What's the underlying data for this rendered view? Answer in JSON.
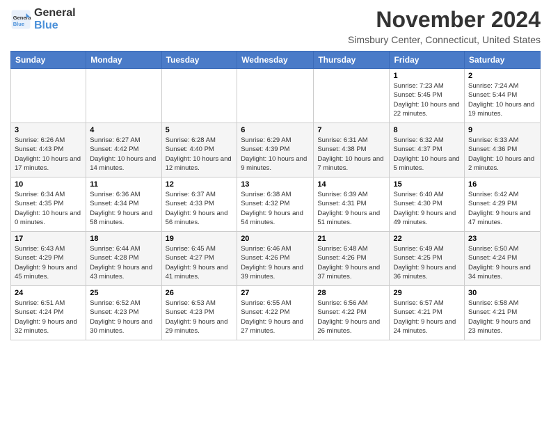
{
  "logo": {
    "line1": "General",
    "line2": "Blue"
  },
  "title": "November 2024",
  "subtitle": "Simsbury Center, Connecticut, United States",
  "weekdays": [
    "Sunday",
    "Monday",
    "Tuesday",
    "Wednesday",
    "Thursday",
    "Friday",
    "Saturday"
  ],
  "weeks": [
    [
      {
        "day": "",
        "info": ""
      },
      {
        "day": "",
        "info": ""
      },
      {
        "day": "",
        "info": ""
      },
      {
        "day": "",
        "info": ""
      },
      {
        "day": "",
        "info": ""
      },
      {
        "day": "1",
        "info": "Sunrise: 7:23 AM\nSunset: 5:45 PM\nDaylight: 10 hours and 22 minutes."
      },
      {
        "day": "2",
        "info": "Sunrise: 7:24 AM\nSunset: 5:44 PM\nDaylight: 10 hours and 19 minutes."
      }
    ],
    [
      {
        "day": "3",
        "info": "Sunrise: 6:26 AM\nSunset: 4:43 PM\nDaylight: 10 hours and 17 minutes."
      },
      {
        "day": "4",
        "info": "Sunrise: 6:27 AM\nSunset: 4:42 PM\nDaylight: 10 hours and 14 minutes."
      },
      {
        "day": "5",
        "info": "Sunrise: 6:28 AM\nSunset: 4:40 PM\nDaylight: 10 hours and 12 minutes."
      },
      {
        "day": "6",
        "info": "Sunrise: 6:29 AM\nSunset: 4:39 PM\nDaylight: 10 hours and 9 minutes."
      },
      {
        "day": "7",
        "info": "Sunrise: 6:31 AM\nSunset: 4:38 PM\nDaylight: 10 hours and 7 minutes."
      },
      {
        "day": "8",
        "info": "Sunrise: 6:32 AM\nSunset: 4:37 PM\nDaylight: 10 hours and 5 minutes."
      },
      {
        "day": "9",
        "info": "Sunrise: 6:33 AM\nSunset: 4:36 PM\nDaylight: 10 hours and 2 minutes."
      }
    ],
    [
      {
        "day": "10",
        "info": "Sunrise: 6:34 AM\nSunset: 4:35 PM\nDaylight: 10 hours and 0 minutes."
      },
      {
        "day": "11",
        "info": "Sunrise: 6:36 AM\nSunset: 4:34 PM\nDaylight: 9 hours and 58 minutes."
      },
      {
        "day": "12",
        "info": "Sunrise: 6:37 AM\nSunset: 4:33 PM\nDaylight: 9 hours and 56 minutes."
      },
      {
        "day": "13",
        "info": "Sunrise: 6:38 AM\nSunset: 4:32 PM\nDaylight: 9 hours and 54 minutes."
      },
      {
        "day": "14",
        "info": "Sunrise: 6:39 AM\nSunset: 4:31 PM\nDaylight: 9 hours and 51 minutes."
      },
      {
        "day": "15",
        "info": "Sunrise: 6:40 AM\nSunset: 4:30 PM\nDaylight: 9 hours and 49 minutes."
      },
      {
        "day": "16",
        "info": "Sunrise: 6:42 AM\nSunset: 4:29 PM\nDaylight: 9 hours and 47 minutes."
      }
    ],
    [
      {
        "day": "17",
        "info": "Sunrise: 6:43 AM\nSunset: 4:29 PM\nDaylight: 9 hours and 45 minutes."
      },
      {
        "day": "18",
        "info": "Sunrise: 6:44 AM\nSunset: 4:28 PM\nDaylight: 9 hours and 43 minutes."
      },
      {
        "day": "19",
        "info": "Sunrise: 6:45 AM\nSunset: 4:27 PM\nDaylight: 9 hours and 41 minutes."
      },
      {
        "day": "20",
        "info": "Sunrise: 6:46 AM\nSunset: 4:26 PM\nDaylight: 9 hours and 39 minutes."
      },
      {
        "day": "21",
        "info": "Sunrise: 6:48 AM\nSunset: 4:26 PM\nDaylight: 9 hours and 37 minutes."
      },
      {
        "day": "22",
        "info": "Sunrise: 6:49 AM\nSunset: 4:25 PM\nDaylight: 9 hours and 36 minutes."
      },
      {
        "day": "23",
        "info": "Sunrise: 6:50 AM\nSunset: 4:24 PM\nDaylight: 9 hours and 34 minutes."
      }
    ],
    [
      {
        "day": "24",
        "info": "Sunrise: 6:51 AM\nSunset: 4:24 PM\nDaylight: 9 hours and 32 minutes."
      },
      {
        "day": "25",
        "info": "Sunrise: 6:52 AM\nSunset: 4:23 PM\nDaylight: 9 hours and 30 minutes."
      },
      {
        "day": "26",
        "info": "Sunrise: 6:53 AM\nSunset: 4:23 PM\nDaylight: 9 hours and 29 minutes."
      },
      {
        "day": "27",
        "info": "Sunrise: 6:55 AM\nSunset: 4:22 PM\nDaylight: 9 hours and 27 minutes."
      },
      {
        "day": "28",
        "info": "Sunrise: 6:56 AM\nSunset: 4:22 PM\nDaylight: 9 hours and 26 minutes."
      },
      {
        "day": "29",
        "info": "Sunrise: 6:57 AM\nSunset: 4:21 PM\nDaylight: 9 hours and 24 minutes."
      },
      {
        "day": "30",
        "info": "Sunrise: 6:58 AM\nSunset: 4:21 PM\nDaylight: 9 hours and 23 minutes."
      }
    ]
  ]
}
